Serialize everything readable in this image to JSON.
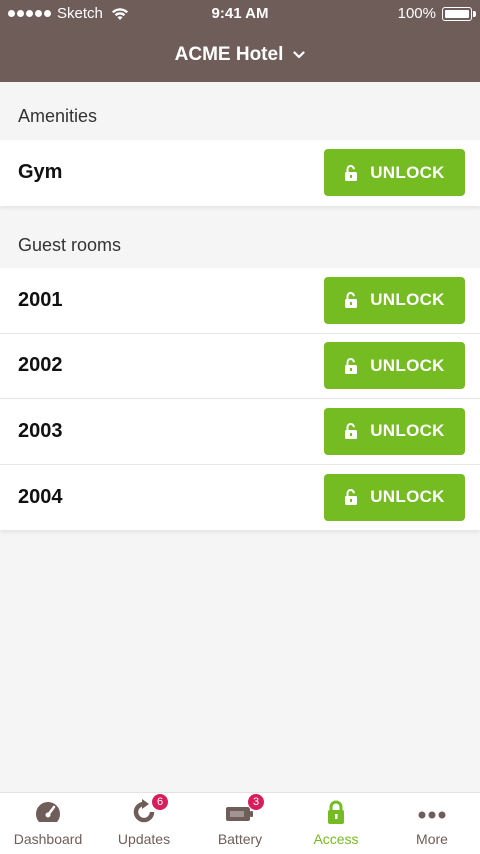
{
  "status_bar": {
    "carrier": "Sketch",
    "time": "9:41 AM",
    "battery": "100%"
  },
  "header": {
    "title": "ACME Hotel"
  },
  "sections": {
    "amenities": {
      "label": "Amenities",
      "items": [
        {
          "name": "Gym",
          "action": "UNLOCK"
        }
      ]
    },
    "guest_rooms": {
      "label": "Guest rooms",
      "items": [
        {
          "name": "2001",
          "action": "UNLOCK"
        },
        {
          "name": "2002",
          "action": "UNLOCK"
        },
        {
          "name": "2003",
          "action": "UNLOCK"
        },
        {
          "name": "2004",
          "action": "UNLOCK"
        }
      ]
    }
  },
  "tabbar": {
    "tabs": [
      {
        "label": "Dashboard",
        "icon": "speedometer-icon",
        "badge": ""
      },
      {
        "label": "Updates",
        "icon": "refresh-icon",
        "badge": "6"
      },
      {
        "label": "Battery",
        "icon": "battery-icon",
        "badge": "3"
      },
      {
        "label": "Access",
        "icon": "lock-icon",
        "badge": ""
      },
      {
        "label": "More",
        "icon": "more-icon",
        "badge": ""
      }
    ],
    "active": "Access"
  },
  "colors": {
    "header": "#6f5d5a",
    "accent": "#75bb22",
    "badge": "#d61f5a",
    "background": "#f5f5f5"
  }
}
